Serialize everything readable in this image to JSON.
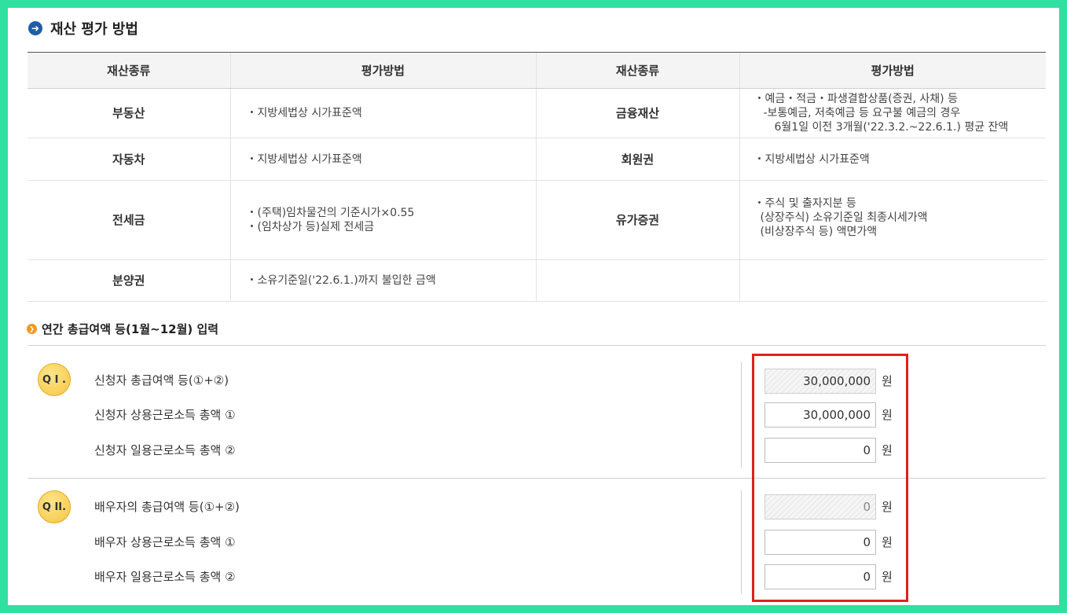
{
  "section_title": "재산 평가 방법",
  "asset_table": {
    "headers": [
      "재산종류",
      "평가방법",
      "재산종류",
      "평가방법"
    ],
    "rows": [
      {
        "kind1": "부동산",
        "method1": [
          "・지방세법상 시가표준액"
        ],
        "kind2": "금융재산",
        "method2": [
          "・예금・적금・파생결합상품(증권, 사채) 등",
          "  -보통예금, 저축예금 등 요구불 예금의 경우",
          "    6월1일 이전 3개월('22.3.2.~22.6.1.) 평균 잔액"
        ]
      },
      {
        "kind1": "자동차",
        "method1": [
          "・지방세법상 시가표준액"
        ],
        "kind2": "회원권",
        "method2": [
          "・지방세법상 시가표준액"
        ]
      },
      {
        "kind1": "전세금",
        "method1": [
          "・(주택)임차물건의 기준시가×0.55",
          "・(임차상가 등)실제 전세금"
        ],
        "kind2": "유가증권",
        "method2": [
          "・주식 및 출자지분 등",
          " (상장주식) 소유기준일 최종시세가액",
          " (비상장주식 등) 액면가액"
        ]
      },
      {
        "kind1": "분양권",
        "method1": [
          "・소유기준일('22.6.1.)까지 불입한 금액"
        ],
        "kind2": "",
        "method2": []
      }
    ]
  },
  "income_title": "연간 총급여액 등(1월~12월) 입력",
  "q1": {
    "badge": "Q I .",
    "rows": [
      {
        "label": "신청자 총급여액 등(①+②)",
        "value": "30,000,000",
        "unit": "원",
        "readonly": true
      },
      {
        "label": "신청자 상용근로소득 총액 ①",
        "value": "30,000,000",
        "unit": "원",
        "readonly": false
      },
      {
        "label": "신청자 일용근로소득 총액 ②",
        "value": "0",
        "unit": "원",
        "readonly": false
      }
    ]
  },
  "q2": {
    "badge": "Q II.",
    "rows": [
      {
        "label": "배우자의 총급여액 등(①+②)",
        "value": "0",
        "unit": "원",
        "readonly": true
      },
      {
        "label": "배우자 상용근로소득 총액 ①",
        "value": "0",
        "unit": "원",
        "readonly": false
      },
      {
        "label": "배우자 일용근로소득 총액 ②",
        "value": "0",
        "unit": "원",
        "readonly": false
      }
    ]
  },
  "colors": {
    "highlight_box": "#e02020",
    "badge": "#f5c542",
    "accent_blue": "#1e5ea8",
    "frame": "#2fe0a0"
  }
}
